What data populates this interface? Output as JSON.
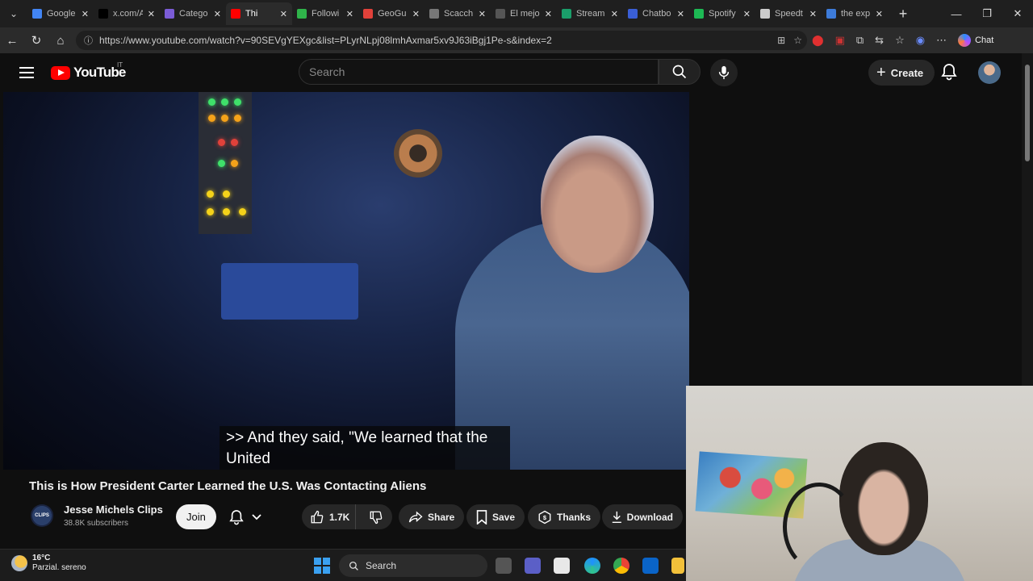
{
  "browser": {
    "tabs": [
      {
        "label": "Google",
        "color": "#4285f4"
      },
      {
        "label": "x.com/A",
        "color": "#000000"
      },
      {
        "label": "Catego",
        "color": "#7b5cd6"
      },
      {
        "label": "Thi",
        "color": "#ff0000",
        "active": true
      },
      {
        "label": "Followi",
        "color": "#2fb34a"
      },
      {
        "label": "GeoGu",
        "color": "#e0413a"
      },
      {
        "label": "Scacch",
        "color": "#777777"
      },
      {
        "label": "El mejo",
        "color": "#555555"
      },
      {
        "label": "Stream",
        "color": "#1a9e6a"
      },
      {
        "label": "Chatbo",
        "color": "#3a5fd6"
      },
      {
        "label": "Spotify",
        "color": "#1db954"
      },
      {
        "label": "Speedt",
        "color": "#cccccc"
      },
      {
        "label": "the exp",
        "color": "#3d7bd9"
      }
    ],
    "url": "https://www.youtube.com/watch?v=90SEVgYEXgc&list=PLyrNLpj08lmhAxmar5xv9J63iBgj1Pe-s&index=2",
    "chat_label": "Chat"
  },
  "youtube": {
    "logo_text": "YouTube",
    "country": "IT",
    "search_placeholder": "Search",
    "create_label": "Create"
  },
  "video": {
    "caption_line1": ">> And they said, \"We learned that the",
    "caption_line2": "United",
    "title": "This is How President Carter Learned the U.S. Was Contacting Aliens"
  },
  "channel": {
    "name": "Jesse Michels Clips",
    "subscribers": "38.8K subscribers",
    "avatar_text": "CLIPS",
    "join_label": "Join"
  },
  "actions": {
    "likes": "1.7K",
    "share": "Share",
    "save": "Save",
    "thanks": "Thanks",
    "download": "Download"
  },
  "taskbar": {
    "temperature": "16°C",
    "weather": "Parzial. sereno",
    "search_label": "Search"
  }
}
